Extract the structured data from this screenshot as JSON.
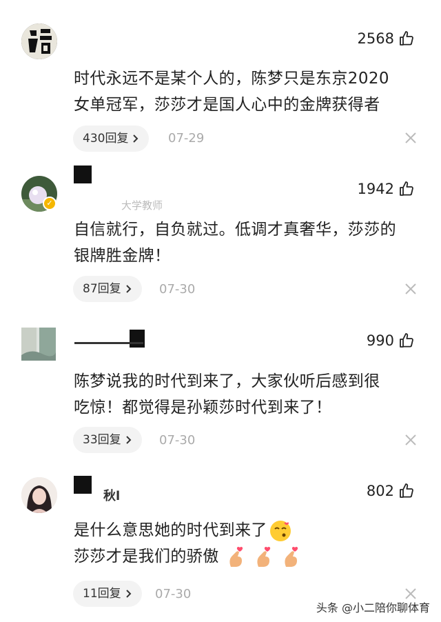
{
  "comments": [
    {
      "avatar_desc": "calligraphy-avatar",
      "name_suffix": "",
      "subtitle": "",
      "likes": "2568",
      "text_lines": [
        "时代永远不是某个人的，陈梦只是东京2020",
        "女单冠军，莎莎才是国人心中的金牌获得者"
      ],
      "replies": "430回复",
      "date": "07-29"
    },
    {
      "avatar_desc": "verified-avatar",
      "name_suffix": "",
      "subtitle": "大学教师",
      "likes": "1942",
      "text_lines": [
        "自信就行，自负就过。低调才真奢华，莎莎的",
        "银牌胜金牌！"
      ],
      "replies": "87回复",
      "date": "07-30"
    },
    {
      "avatar_desc": "landscape-avatar",
      "name_suffix": "",
      "subtitle": "",
      "likes": "990",
      "text_lines": [
        "陈梦说我的时代到来了，大家伙听后感到很",
        "吃惊！都觉得是孙颖莎时代到来了！"
      ],
      "replies": "33回复",
      "date": "07-30"
    },
    {
      "avatar_desc": "woman-avatar",
      "name_suffix": "秋l",
      "subtitle": "",
      "likes": "802",
      "text_lines": [
        "是什么意思她的时代到来了",
        "莎莎才是我们的骄傲"
      ],
      "replies": "11回复",
      "date": "07-30"
    }
  ],
  "watermark": "头条 @小二陪你聊体育",
  "icons": {
    "like": "thumbs-up-icon",
    "close": "close-icon",
    "chevron": "chevron-right-icon",
    "verified": "verified-badge-icon",
    "emoji_kiss": "kissing-face-emoji",
    "emoji_heart_hand": "finger-heart-emoji"
  },
  "colors": {
    "verified": "#f5b700",
    "pill_bg": "#f3f3f3",
    "muted": "#aaaaaa"
  }
}
